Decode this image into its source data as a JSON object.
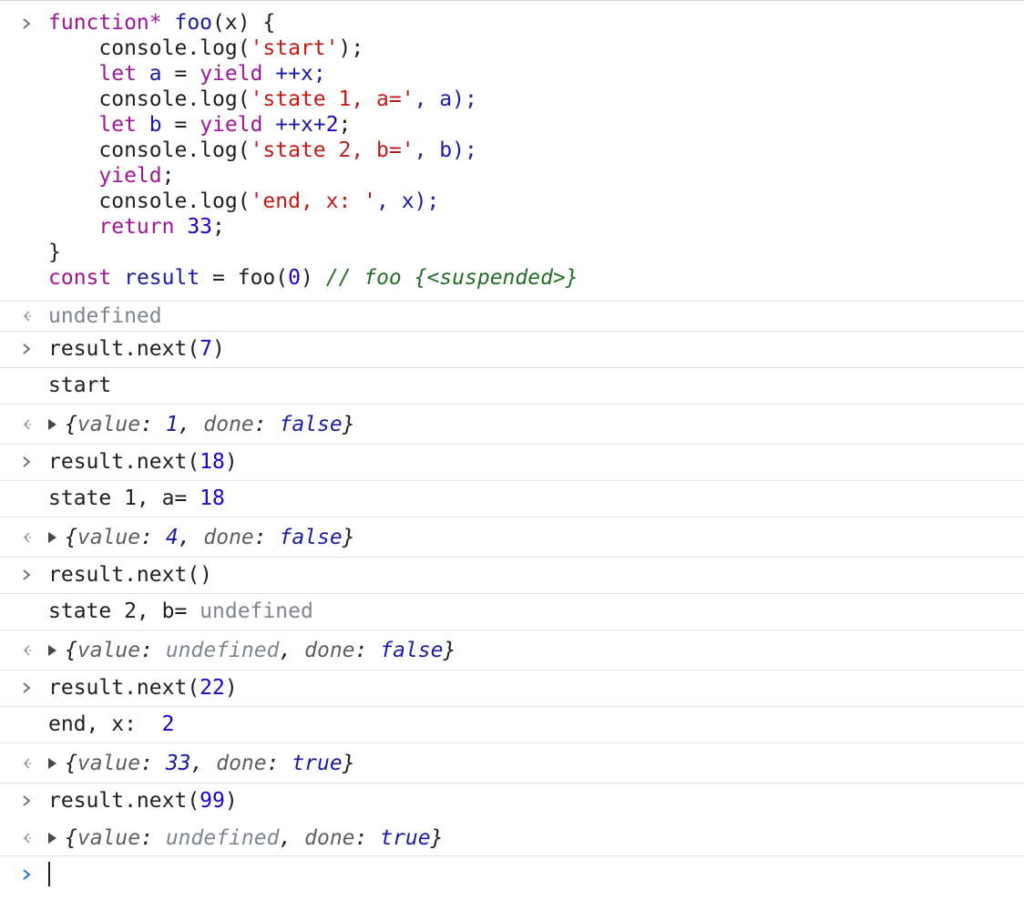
{
  "console": {
    "input_block": {
      "lines": [
        [
          "function* ",
          "foo",
          "(x) {"
        ],
        [
          "    console.log(",
          "'start'",
          ");"
        ],
        [
          "    let ",
          "a",
          " = ",
          "yield",
          " ++x;"
        ],
        [
          "    console.log(",
          "'state 1, a='",
          ", a);"
        ],
        [
          "    let ",
          "b",
          " = ",
          "yield",
          " ++x+",
          "2",
          ";"
        ],
        [
          "    console.log(",
          "'state 2, b='",
          ", b);"
        ],
        [
          "    yield",
          ";"
        ],
        [
          "    console.log(",
          "'end, x: '",
          ", x);"
        ],
        [
          "    return ",
          "33",
          ";"
        ],
        [
          "}"
        ],
        [
          "const ",
          "result",
          " = foo(",
          "0",
          ") ",
          "// foo {<suspended>}"
        ]
      ]
    },
    "entries": [
      {
        "kind": "result",
        "text": "undefined"
      },
      {
        "kind": "input",
        "text_a": "result.next(",
        "num": "7",
        "text_b": ")"
      },
      {
        "kind": "log",
        "text": "start"
      },
      {
        "kind": "result_obj",
        "k1": "value",
        "v1": "1",
        "k2": "done",
        "v2": "false"
      },
      {
        "kind": "input",
        "text_a": "result.next(",
        "num": "18",
        "text_b": ")"
      },
      {
        "kind": "log_num",
        "text": "state 1, a= ",
        "num": "18"
      },
      {
        "kind": "result_obj",
        "k1": "value",
        "v1": "4",
        "k2": "done",
        "v2": "false"
      },
      {
        "kind": "input",
        "text_a": "result.next(",
        "num": "",
        "text_b": ")"
      },
      {
        "kind": "log_undef",
        "text": "state 2, b= ",
        "undef": "undefined"
      },
      {
        "kind": "result_obj_undef",
        "k1": "value",
        "v1": "undefined",
        "k2": "done",
        "v2": "false"
      },
      {
        "kind": "input",
        "text_a": "result.next(",
        "num": "22",
        "text_b": ")"
      },
      {
        "kind": "log_num",
        "text": "end, x:  ",
        "num": "2"
      },
      {
        "kind": "result_obj",
        "k1": "value",
        "v1": "33",
        "k2": "done",
        "v2": "true"
      },
      {
        "kind": "input",
        "text_a": "result.next(",
        "num": "99",
        "text_b": ")"
      },
      {
        "kind": "result_obj_undef",
        "k1": "value",
        "v1": "undefined",
        "k2": "done",
        "v2": "true"
      }
    ],
    "prompt_symbol": ">",
    "result_symbol": "←",
    "colors": {
      "keyword": "#a0159a",
      "function_name": "#1a1aa6",
      "string": "#c41a16",
      "number": "#1c00cf",
      "comment": "#236e25",
      "undefined": "#80868b",
      "prompt_active": "#1a73e8"
    }
  }
}
